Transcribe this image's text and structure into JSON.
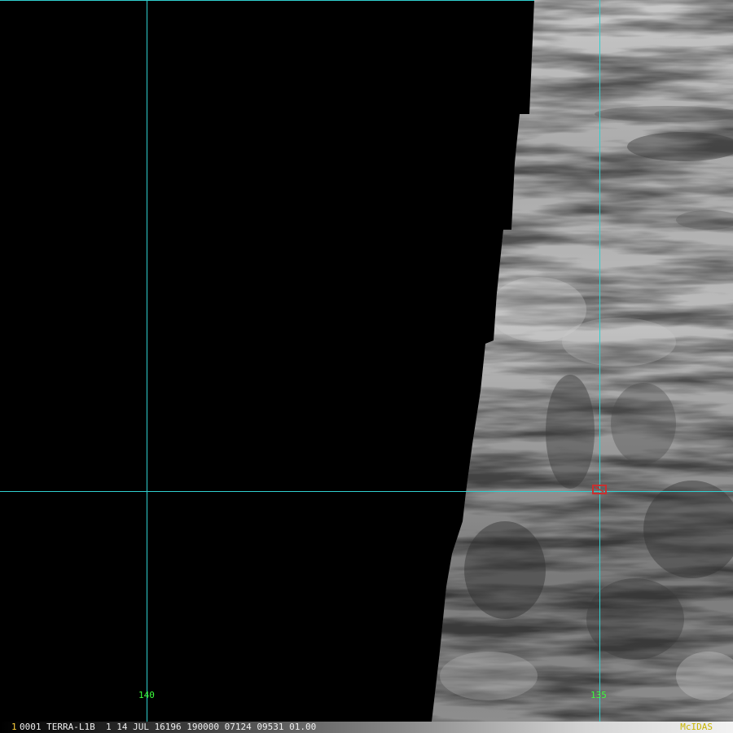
{
  "image": {
    "longitude_labels": [
      "140",
      "135"
    ],
    "grid_line_color": "#30d0d0",
    "longitude_label_color": "#3cff3c",
    "storm_marker_color": "#c83030"
  },
  "status_bar": {
    "frame_index": "1",
    "frame_info": "0001 TERRA-L1B  1 14 JUL 16196 190000 07124 09531 01.00",
    "software": "McIDAS"
  }
}
